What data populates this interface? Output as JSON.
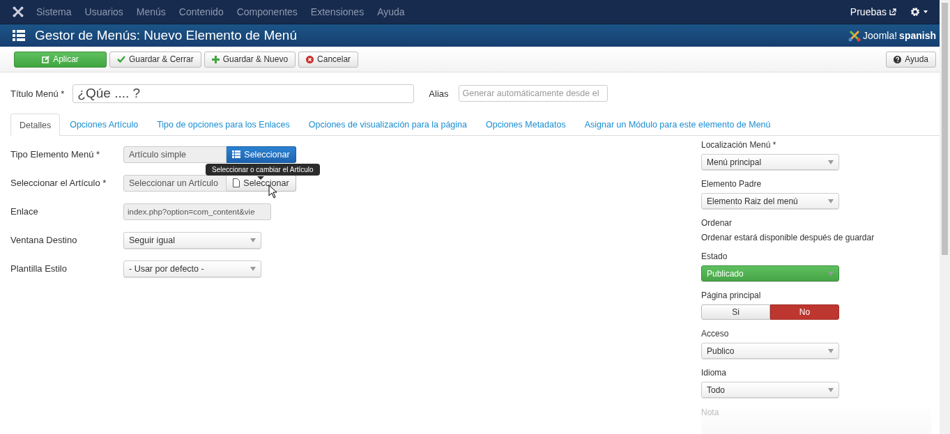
{
  "top_menu": [
    "Sistema",
    "Usuarios",
    "Menús",
    "Contenido",
    "Componentes",
    "Extensiones",
    "Ayuda"
  ],
  "site_link": "Pruebas",
  "header": {
    "title": "Gestor de Menús: Nuevo Elemento de Menú",
    "logo_text": "Joomla!",
    "logo_suffix": "spanish"
  },
  "toolbar": [
    {
      "label": "Aplicar",
      "kind": "apply"
    },
    {
      "label": "Guardar & Cerrar",
      "kind": "save"
    },
    {
      "label": "Guardar & Nuevo",
      "kind": "new"
    },
    {
      "label": "Cancelar",
      "kind": "cancel"
    }
  ],
  "help_button": "Ayuda",
  "title_field": {
    "label": "Título Menú *",
    "value": "¿Qúe .... ?"
  },
  "alias_field": {
    "label": "Alias",
    "placeholder": "Generar automáticamente desde el"
  },
  "tabs": [
    {
      "label": "Detalles",
      "selected": true
    },
    {
      "label": "Opciones Artículo",
      "selected": false
    },
    {
      "label": "Tipo de opciones para los Enlaces",
      "selected": false
    },
    {
      "label": "Opciones de visualización para la página",
      "selected": false
    },
    {
      "label": "Opciones Metadatos",
      "selected": false
    },
    {
      "label": "Asignar un Módulo para este elemento de Menú",
      "selected": false
    }
  ],
  "left_fields": [
    {
      "kind": "picker",
      "label": "Tipo Elemento Menú *",
      "value": "Artículo simple",
      "button": "Seleccionar",
      "primary": true
    },
    {
      "kind": "picker",
      "label": "Seleccionar el Artículo *",
      "value": "Seleccionar un Artículo",
      "button": "Seleccionar",
      "primary": false
    },
    {
      "kind": "readonly",
      "label": "Enlace",
      "value": "index.php?option=com_content&vie"
    },
    {
      "kind": "select",
      "label": "Ventana Destino",
      "value": "Seguir igual"
    },
    {
      "kind": "select",
      "label": "Plantilla Estilo",
      "value": "- Usar por defecto -"
    }
  ],
  "tooltip": "Seleccionar o cambiar el Artículo",
  "right_fields": [
    {
      "kind": "select",
      "label": "Localización Menú *",
      "value": "Menú principal"
    },
    {
      "kind": "select",
      "label": "Elemento Padre",
      "value": "Elemento Raiz del menú"
    },
    {
      "kind": "note",
      "label": "Ordenar",
      "value": "Ordenar estará disponible después de guardar"
    },
    {
      "kind": "status",
      "label": "Estado",
      "value": "Publicado"
    },
    {
      "kind": "toggle",
      "label": "Página principal",
      "options": [
        {
          "label": "Si",
          "selected": false
        },
        {
          "label": "No",
          "selected": true
        }
      ]
    },
    {
      "kind": "select",
      "label": "Acceso",
      "value": "Publico"
    },
    {
      "kind": "select",
      "label": "Idioma",
      "value": "Todo"
    },
    {
      "kind": "faded",
      "label": "Nota"
    }
  ]
}
